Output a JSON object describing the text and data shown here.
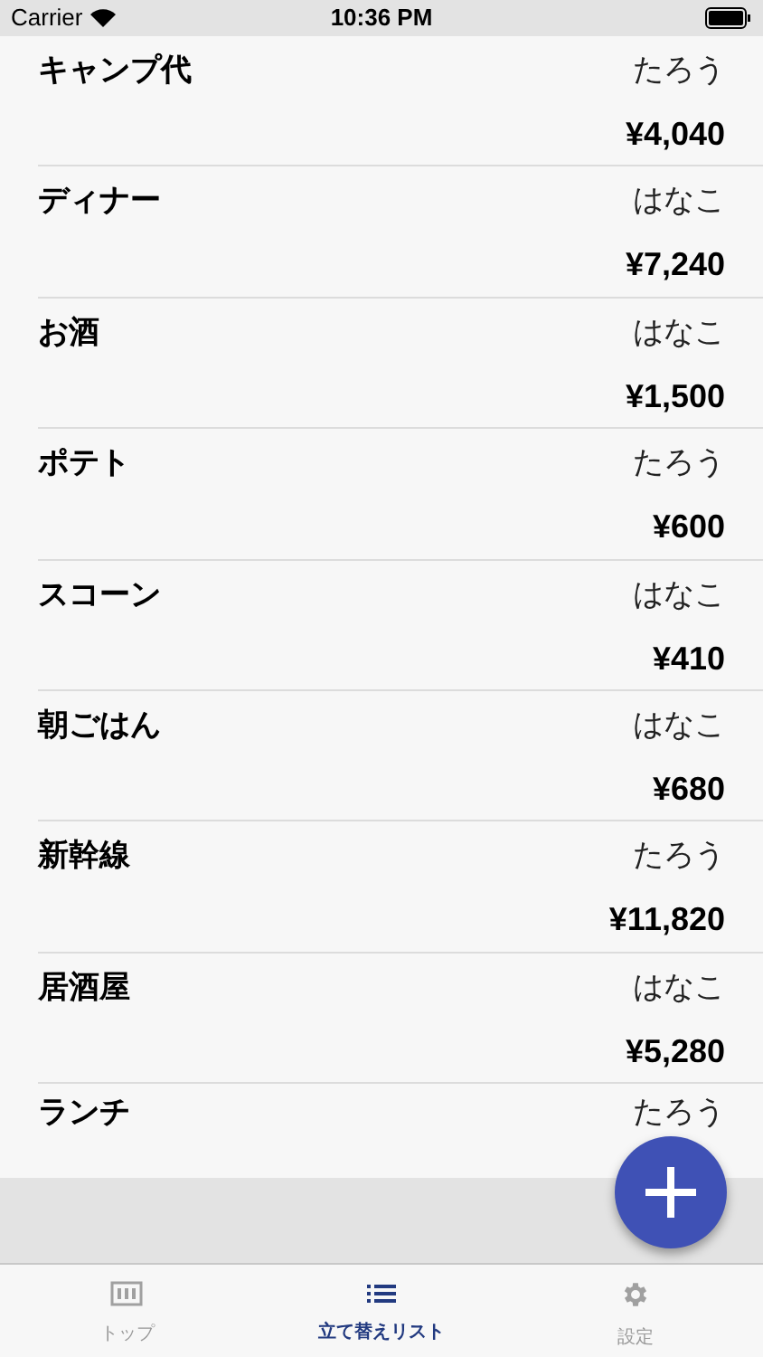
{
  "status_bar": {
    "carrier": "Carrier",
    "time": "10:36 PM"
  },
  "expenses": [
    {
      "name": "キャンプ代",
      "payer": "たろう",
      "amount": "¥4,040"
    },
    {
      "name": "ディナー",
      "payer": "はなこ",
      "amount": "¥7,240"
    },
    {
      "name": "お酒",
      "payer": "はなこ",
      "amount": "¥1,500"
    },
    {
      "name": "ポテト",
      "payer": "たろう",
      "amount": "¥600"
    },
    {
      "name": "スコーン",
      "payer": "はなこ",
      "amount": "¥410"
    },
    {
      "name": "朝ごはん",
      "payer": "はなこ",
      "amount": "¥680"
    },
    {
      "name": "新幹線",
      "payer": "たろう",
      "amount": "¥11,820"
    },
    {
      "name": "居酒屋",
      "payer": "はなこ",
      "amount": "¥5,280"
    },
    {
      "name": "ランチ",
      "payer": "たろう"
    }
  ],
  "tabs": [
    {
      "kind": "score",
      "label": "トップ",
      "selected": false
    },
    {
      "kind": "list",
      "label": "立て替えリスト",
      "selected": true
    },
    {
      "kind": "gear",
      "label": "設定",
      "selected": false
    }
  ]
}
